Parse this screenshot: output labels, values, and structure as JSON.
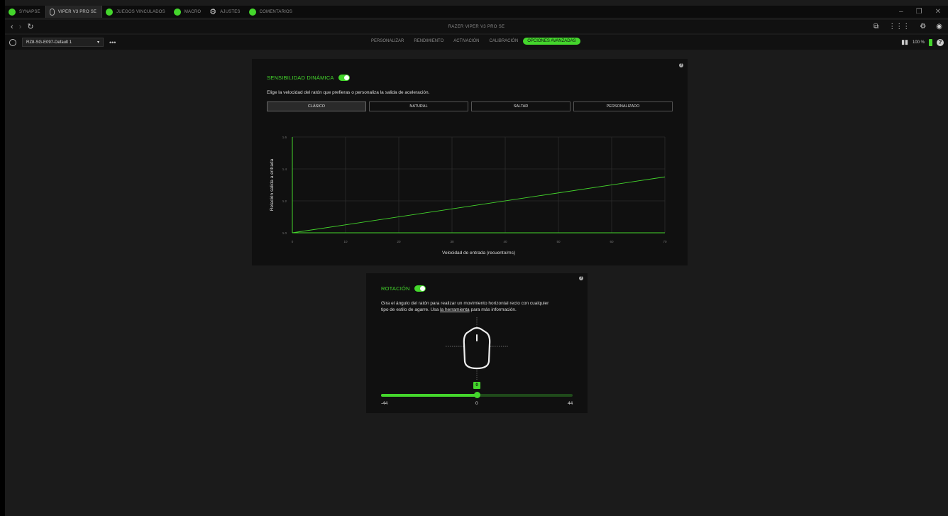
{
  "tabs": [
    {
      "label": "SYNAPSE",
      "icon": "synapse-icon",
      "active": false
    },
    {
      "label": "VIPER V3 PRO SE",
      "icon": "mouse-icon",
      "active": true
    },
    {
      "label": "JUEGOS VINCULADOS",
      "icon": "gamepad-icon",
      "active": false
    },
    {
      "label": "MACRO",
      "icon": "macro-icon",
      "active": false
    },
    {
      "label": "AJUSTES",
      "icon": "gear-icon",
      "active": false
    },
    {
      "label": "COMENTARIOS",
      "icon": "feedback-icon",
      "active": false
    }
  ],
  "nav": {
    "title": "RAZER VIPER V3 PRO SE"
  },
  "profile": {
    "selected": "RZ8-SG-E097-Default 1"
  },
  "subtabs": [
    {
      "label": "PERSONALIZAR",
      "active": false
    },
    {
      "label": "RENDIMIENTO",
      "active": false
    },
    {
      "label": "ACTIVACIÓN",
      "active": false
    },
    {
      "label": "CALIBRACIÓN",
      "active": false
    },
    {
      "label": "OPCIONES AVANZADAS",
      "active": true
    }
  ],
  "status": {
    "battery": "100 %"
  },
  "sensitivity": {
    "title": "SENSIBILIDAD DINÁMICA",
    "enabled": true,
    "description": "Elige la velocidad del ratón que prefieras o personaliza la salida de aceleración.",
    "modes": [
      {
        "label": "CLÁSICO",
        "active": true
      },
      {
        "label": "NATURAL",
        "active": false
      },
      {
        "label": "SALTAR",
        "active": false
      },
      {
        "label": "PERSONALIZADO",
        "active": false
      }
    ]
  },
  "chart_data": {
    "type": "line",
    "xlabel": "Velocidad de entrada (recuento/ms)",
    "ylabel": "Relación salida a entrada",
    "xlim": [
      0,
      70
    ],
    "ylim": [
      1.0,
      1.6
    ],
    "xticks": [
      "0",
      "10",
      "20",
      "30",
      "40",
      "50",
      "60",
      "70"
    ],
    "yticks": [
      "1.0",
      "1.2",
      "1.4",
      "1.6"
    ],
    "grid": true,
    "series": [
      {
        "x": [
          0,
          70
        ],
        "values": [
          1.0,
          1.35
        ]
      }
    ],
    "colors": {
      "line": "#44d62c",
      "grid": "#2c2c2c",
      "axis": "#44d62c"
    }
  },
  "rotation": {
    "title": "ROTACIÓN",
    "enabled": true,
    "desc_line1": "Gira el ángulo del ratón para realizar un movimiento horizontal recto con cualquier",
    "desc_line2_pre": "tipo de estilo de agarre. Usa ",
    "desc_link": "la herramienta",
    "desc_line2_post": " para más información.",
    "min": -44,
    "max": 44,
    "value": 0,
    "min_label": "-44",
    "max_label": "44",
    "value_label": "0",
    "badge": "0"
  },
  "colors": {
    "accent": "#44d62c",
    "panel": "#101010",
    "background": "#1b1b1b"
  }
}
